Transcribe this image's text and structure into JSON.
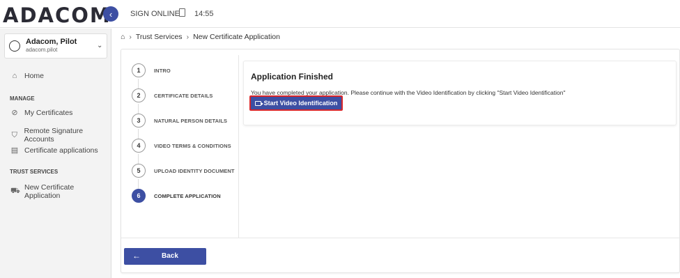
{
  "header": {
    "logo": "ADACOM",
    "collapse_icon": "‹",
    "app_name": "SIGN ONLINE",
    "time": "14:55"
  },
  "user": {
    "name": "Adacom, Pilot",
    "username": "adacom.pilot"
  },
  "sidebar": {
    "home": "Home",
    "manage_heading": "MANAGE",
    "manage_items": [
      "My Certificates",
      "Remote Signature Accounts",
      "Certificate applications"
    ],
    "trust_heading": "TRUST SERVICES",
    "trust_items": [
      "New Certificate Application"
    ]
  },
  "breadcrumb": {
    "items": [
      "Trust Services",
      "New Certificate Application"
    ]
  },
  "steps": [
    {
      "num": "1",
      "label": "INTRO"
    },
    {
      "num": "2",
      "label": "CERTIFICATE DETAILS"
    },
    {
      "num": "3",
      "label": "NATURAL PERSON DETAILS"
    },
    {
      "num": "4",
      "label": "VIDEO TERMS & CONDITIONS"
    },
    {
      "num": "5",
      "label": "UPLOAD IDENTITY DOCUMENT"
    },
    {
      "num": "6",
      "label": "COMPLETE APPLICATION"
    }
  ],
  "result": {
    "title": "Application Finished",
    "message": "You have completed your application. Please continue with the Video Identification by clicking \"Start Video Identification\"",
    "button": "Start Video Identification"
  },
  "footer": {
    "back": "Back"
  },
  "colors": {
    "primary": "#3d4fa3",
    "highlight_border": "#d9262a"
  }
}
